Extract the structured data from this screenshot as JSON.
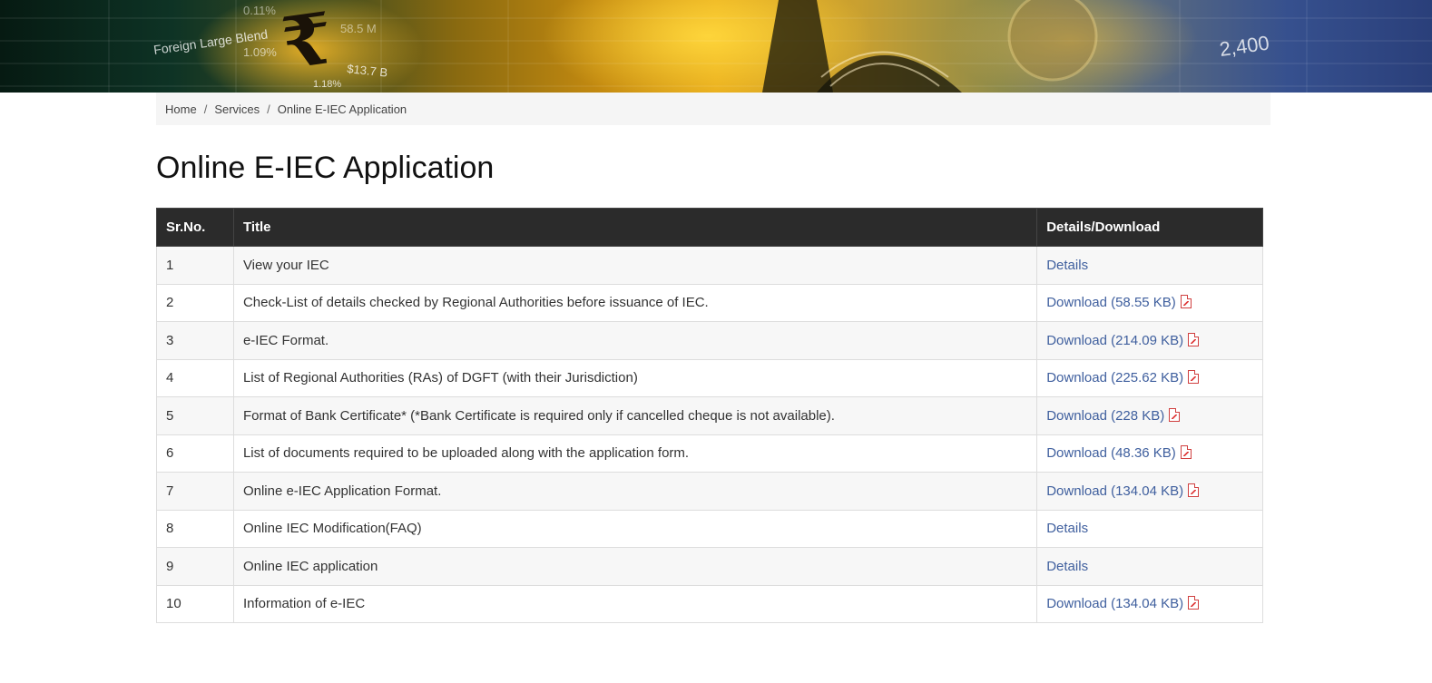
{
  "breadcrumb": {
    "home": "Home",
    "services": "Services",
    "current": "Online E-IEC Application",
    "separator": "/"
  },
  "page": {
    "title": "Online E-IEC Application"
  },
  "table": {
    "headers": [
      "Sr.No.",
      "Title",
      "Details/Download"
    ],
    "rows": [
      {
        "sr": "1",
        "title": "View your IEC",
        "link": "Details",
        "pdf": false
      },
      {
        "sr": "2",
        "title": "Check-List of details checked by Regional Authorities before issuance of IEC.",
        "link": "Download (58.55 KB)",
        "pdf": true
      },
      {
        "sr": "3",
        "title": "e-IEC Format.",
        "link": "Download (214.09 KB)",
        "pdf": true
      },
      {
        "sr": "4",
        "title": "List of Regional Authorities (RAs) of DGFT (with their Jurisdiction)",
        "link": "Download (225.62 KB)",
        "pdf": true
      },
      {
        "sr": "5",
        "title": "Format of Bank Certificate* (*Bank Certificate is required only if cancelled cheque is not available).",
        "link": "Download (228 KB)",
        "pdf": true
      },
      {
        "sr": "6",
        "title": "List of documents required to be uploaded along with the application form.",
        "link": "Download (48.36 KB)",
        "pdf": true
      },
      {
        "sr": "7",
        "title": "Online e-IEC Application Format.",
        "link": "Download (134.04 KB)",
        "pdf": true
      },
      {
        "sr": "8",
        "title": "Online IEC Modification(FAQ)",
        "link": "Details",
        "pdf": false
      },
      {
        "sr": "9",
        "title": "Online IEC application",
        "link": "Details",
        "pdf": false
      },
      {
        "sr": "10",
        "title": "Information of e-IEC",
        "link": "Download (134.04 KB)",
        "pdf": true
      }
    ]
  },
  "banner": {
    "texts": [
      "Foreign Large Blend",
      "1.18%",
      "2,400",
      "$13.7 B",
      "0.11%",
      "1.09%",
      "58.5 M"
    ]
  },
  "colors": {
    "header_bg": "#2b2b2b",
    "link": "#3f5f9e",
    "breadcrumb_bg": "#f5f5f5",
    "pdf_icon": "#d04040"
  },
  "icons": {
    "pdf": "pdf-icon",
    "rupee": "rupee-icon"
  }
}
